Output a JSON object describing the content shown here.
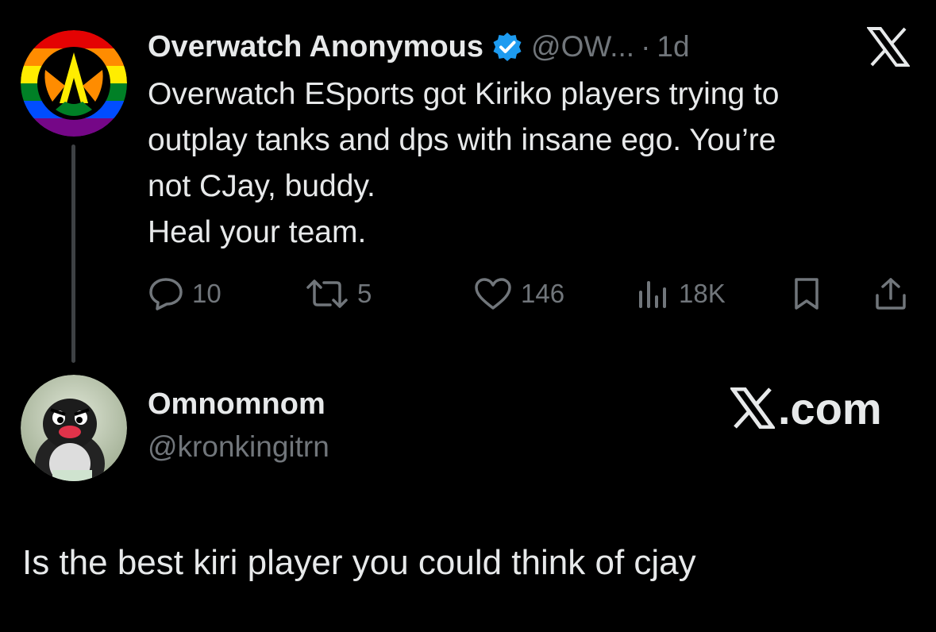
{
  "post": {
    "author_name": "Overwatch Anonymous",
    "handle": "@OW...",
    "separator": "·",
    "time": "1d",
    "lines": [
      "Overwatch ESports got Kiriko players trying to",
      "outplay tanks and dps with insane ego. You’re",
      "not CJay, buddy.",
      "Heal your team."
    ],
    "stats": {
      "replies": "10",
      "reposts": "5",
      "likes": "146",
      "views": "18K"
    },
    "icons": {
      "avatar": "overwatch-pride-logo",
      "verified": "verified-badge-icon",
      "x_logo": "x-logo-icon",
      "reply": "reply-icon",
      "repost": "repost-icon",
      "like": "heart-icon",
      "views": "views-icon",
      "bookmark": "bookmark-icon",
      "share": "share-icon"
    }
  },
  "quoted_user": {
    "name": "Omnomnom",
    "handle": "@kronkingitrn",
    "avatar": "angry-penguin-avatar"
  },
  "watermark": {
    "text": ".com",
    "icon": "x-logo-icon"
  },
  "reply_text": "Is the best kiri player you could think of cjay",
  "colors": {
    "background": "#000000",
    "primary_text": "#e7e9ea",
    "secondary_text": "#71767b",
    "verified_blue": "#1d9bf0"
  }
}
